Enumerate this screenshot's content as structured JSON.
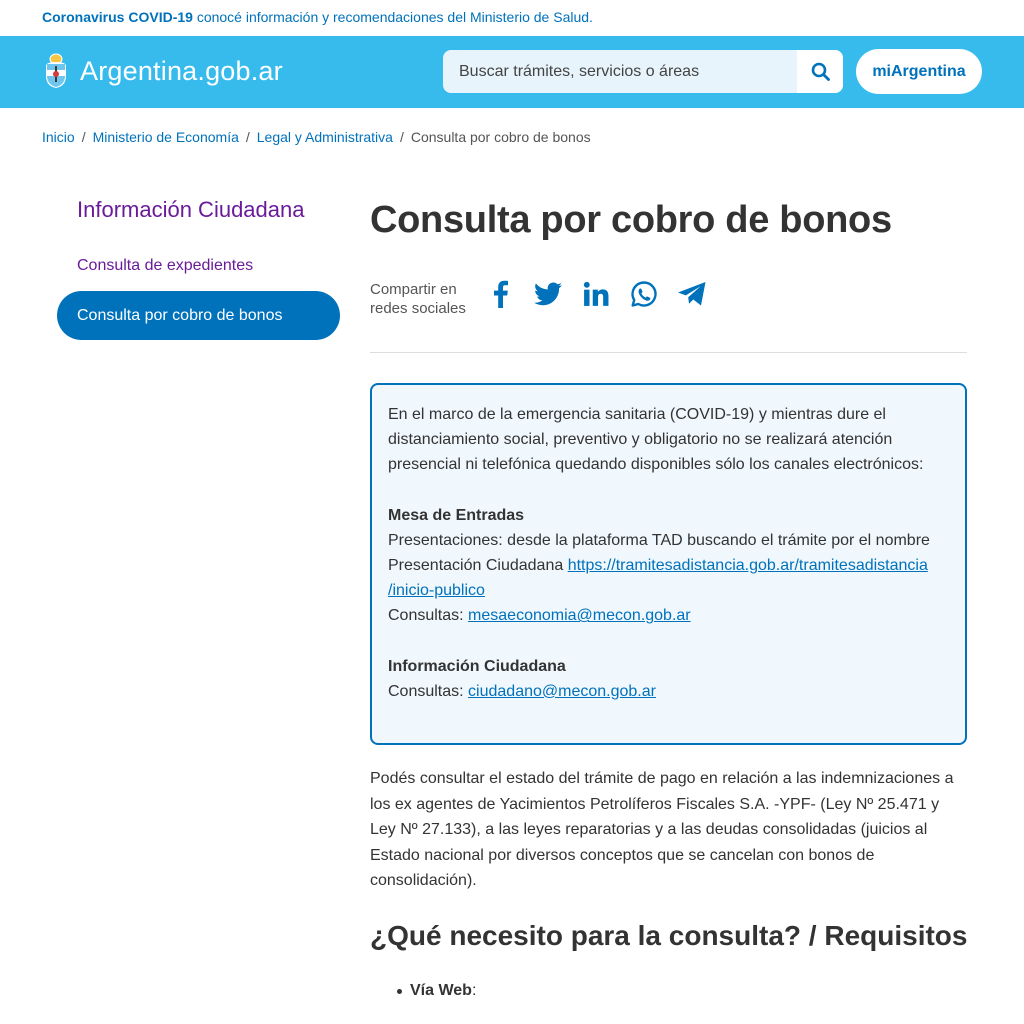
{
  "covid_bar": {
    "strong": "Coronavirus COVID-19",
    "text": " conocé información y recomendaciones del Ministerio de Salud."
  },
  "header": {
    "brand": "Argentina.gob.ar",
    "search_placeholder": "Buscar trámites, servicios o áreas",
    "mi_argentina": "miArgentina",
    "colors": {
      "bar": "#37bbed",
      "accent": "#0072bb"
    }
  },
  "breadcrumb": {
    "items": [
      "Inicio",
      "Ministerio de Economía",
      "Legal y Administrativa"
    ],
    "current": "Consulta por cobro de bonos"
  },
  "sidebar": {
    "title": "Información Ciudadana",
    "items": [
      {
        "label": "Consulta de expedientes",
        "active": false
      },
      {
        "label": "Consulta por cobro de bonos",
        "active": true
      }
    ]
  },
  "main": {
    "title": "Consulta por cobro de bonos",
    "share_label": "Compartir en redes sociales",
    "share_icons": [
      "facebook-icon",
      "twitter-icon",
      "linkedin-icon",
      "whatsapp-icon",
      "telegram-icon"
    ],
    "notice": {
      "intro": "En el marco de la emergencia sanitaria (COVID-19) y mientras dure el distanciamiento social, preventivo y obligatorio no se realizará atención presencial ni telefónica quedando disponibles sólo los canales electrónicos:",
      "mesa_title": "Mesa de Entradas",
      "mesa_pres_1": "Presentaciones: desde la plataforma TAD buscando el trámite por el nombre",
      "mesa_pres_2": "Presentación Ciudadana ",
      "mesa_link_a": "https://tramitesadistancia.gob.ar/tramitesadistancia",
      "mesa_link_b": "/inicio-publico",
      "mesa_consultas_label": "Consultas: ",
      "mesa_email": "mesaeconomia@mecon.gob.ar",
      "info_title": "Información Ciudadana",
      "info_consultas_label": "Consultas: ",
      "info_email": "ciudadano@mecon.gob.ar"
    },
    "intro_paragraph": "Podés consultar el estado del trámite de pago en relación a las indemnizaciones a los ex agentes de Yacimientos Petrolíferos Fiscales S.A. -YPF- (Ley Nº 25.471 y Ley Nº 27.133), a las leyes reparatorias y a las deudas consolidadas (juicios al Estado nacional por diversos conceptos que se cancelan con bonos de consolidación).",
    "section_title": "¿Qué necesito para la consulta? / Requisitos",
    "bullet_label": "Vía Web",
    "bullet_suffix": ":"
  }
}
